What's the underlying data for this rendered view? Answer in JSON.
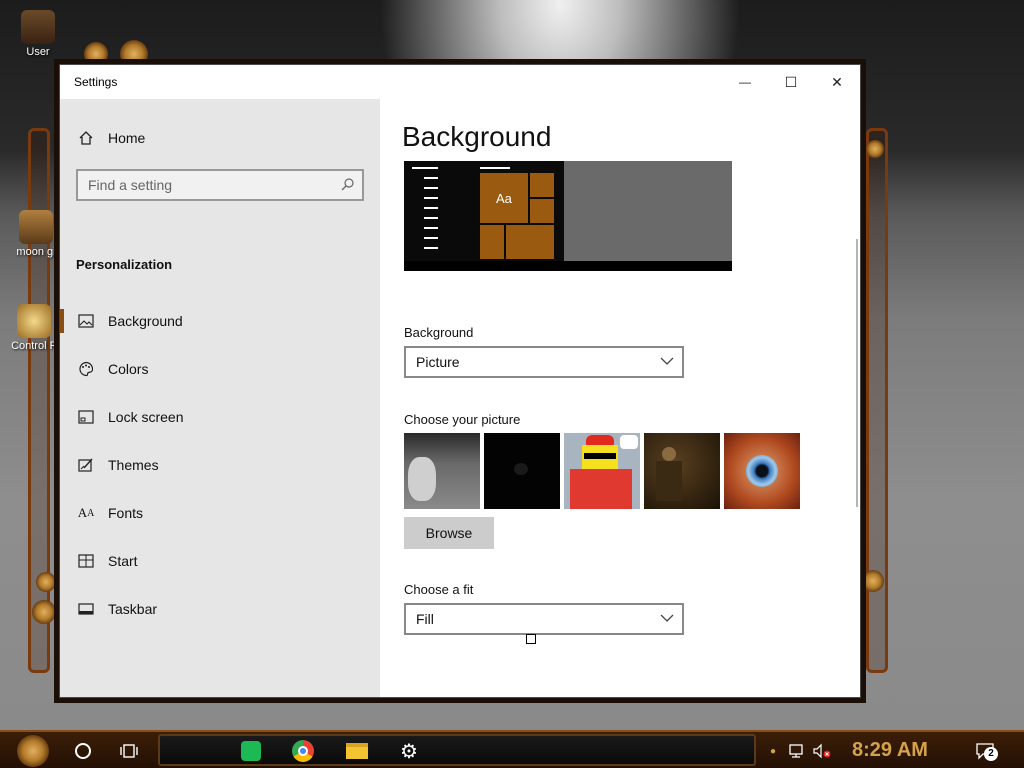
{
  "desktop": {
    "icons": [
      {
        "label": "User"
      },
      {
        "label": "moon gi"
      },
      {
        "label": "Control P"
      }
    ]
  },
  "window": {
    "title": "Settings",
    "controls": {
      "minimize": "—",
      "maximize": "☐",
      "close": "✕"
    }
  },
  "nav": {
    "home": "Home",
    "search_placeholder": "Find a setting",
    "section": "Personalization",
    "items": [
      {
        "label": "Background",
        "icon": "image-icon",
        "selected": true
      },
      {
        "label": "Colors",
        "icon": "palette-icon"
      },
      {
        "label": "Lock screen",
        "icon": "lock-screen-icon"
      },
      {
        "label": "Themes",
        "icon": "themes-icon"
      },
      {
        "label": "Fonts",
        "icon": "fonts-icon"
      },
      {
        "label": "Start",
        "icon": "start-icon"
      },
      {
        "label": "Taskbar",
        "icon": "taskbar-icon"
      }
    ]
  },
  "content": {
    "title": "Background",
    "preview_sample": "Aa",
    "background_label": "Background",
    "background_value": "Picture",
    "choose_picture_label": "Choose your picture",
    "browse_label": "Browse",
    "fit_label": "Choose a fit",
    "fit_value": "Fill",
    "thumbnails": [
      "teddy-bear-photo",
      "dark-photo",
      "cartoon-character-photo",
      "steampunk-figure-photo",
      "eye-photo"
    ]
  },
  "taskbar": {
    "time": "8:29 AM",
    "notification_count": "2",
    "apps": [
      "start-gear-icon",
      "cortana-icon",
      "task-view-icon",
      "notes-app-icon",
      "chrome-icon",
      "file-explorer-icon",
      "settings-icon"
    ]
  },
  "colors": {
    "accent": "#8a4d13",
    "accent_tile": "#9a5a10",
    "clock": "#d4a24a"
  }
}
